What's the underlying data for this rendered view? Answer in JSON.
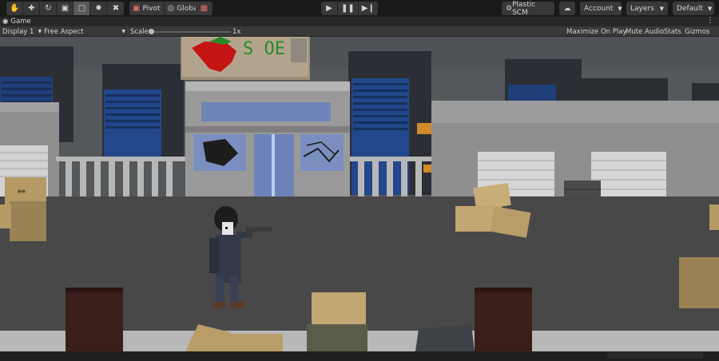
{
  "toolbar": {
    "tools": [
      "hand-tool",
      "move-tool",
      "rotate-tool",
      "scale-tool",
      "rect-tool",
      "transform-tool",
      "custom-tool"
    ],
    "pivot_label": "Pivot",
    "global_label": "Global",
    "plastic_label": "Plastic SCM",
    "account_label": "Account",
    "layers_label": "Layers",
    "layout_label": "Default"
  },
  "tab": {
    "label": "Game"
  },
  "game_toolbar": {
    "display": "Display 1",
    "aspect": "Free Aspect",
    "scale_label": "Scale",
    "scale_value": "1x",
    "scale_level": 0,
    "maximize": "Maximize On Play",
    "mute": "Mute Audio",
    "stats": "Stats",
    "gizmos": "Gizmos"
  },
  "colors": {
    "sky": "#56595c",
    "street": "#484848",
    "building_blue": "#2a4d8c",
    "accent_red": "#c41414",
    "graffiti_green": "#2a8a2a"
  }
}
